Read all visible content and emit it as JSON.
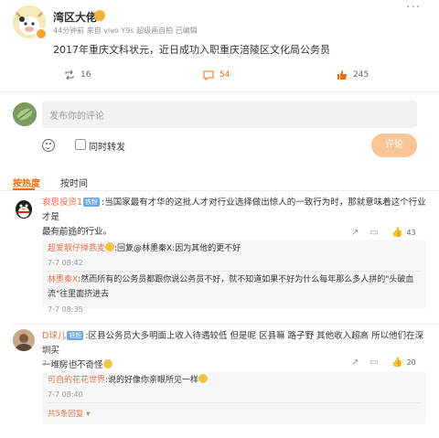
{
  "post": {
    "author": "湾区大佬",
    "meta": "44分钟前  来自 vivo Y9s  超级画自拍  已编辑",
    "text": "2017年重庆文科状元，近日成功入职重庆涪陵区文化局公务员",
    "repost_count": "16",
    "comment_count": "54",
    "like_count": "245",
    "more": "···"
  },
  "compose": {
    "placeholder": "发布你的评论",
    "repost_checkbox_label": "同时转发",
    "submit_label": "评论"
  },
  "sort_tabs": {
    "hot": "按热度",
    "time": "按时间"
  },
  "comments": [
    {
      "user": "哀思投资1",
      "badge": "铁粉",
      "text_line1": ":当国家最有才华的这批人才对行业选择做出惊人的一致行为时，那就意味着这个行业才是",
      "text_line2": "最有前途的行业。",
      "time": "7-7 08:22",
      "likes": "43",
      "replies": [
        {
          "user": "超爱靓仔掸燕麦",
          "text": ":回复@林墨秦X:因为其他的更不好",
          "time": "7-7 08:42"
        },
        {
          "user": "林墨秦X",
          "text_line1": ":然而所有的公务员都跟你说公务员不好，就不知道如果不好为什么每年那么多人拼的\"头破血",
          "text_line2": "流\"往里面挤进去",
          "time": "7-7 08:35"
        }
      ]
    },
    {
      "user": "D球儿",
      "badge": "铁粉",
      "text_line1": ":区县公务员大多明面上收入待遇较低 但是呢 区县嘛 路子野 其他收入超高 所以他们在深圳买",
      "text_line2": "一堆房也不奇怪",
      "time": "7-7 08:13",
      "likes": "20",
      "replies": [
        {
          "user": "可自的花花世界",
          "text": ":说的好像你亲眼所见一样",
          "time": "7-7 08:40"
        }
      ],
      "more_replies": "共5条回复 ▾"
    }
  ],
  "colors": {
    "accent": "#f36b0b",
    "name": "#eb7350",
    "badge": "#6da7e0",
    "submit_disabled": "#fcc596"
  }
}
